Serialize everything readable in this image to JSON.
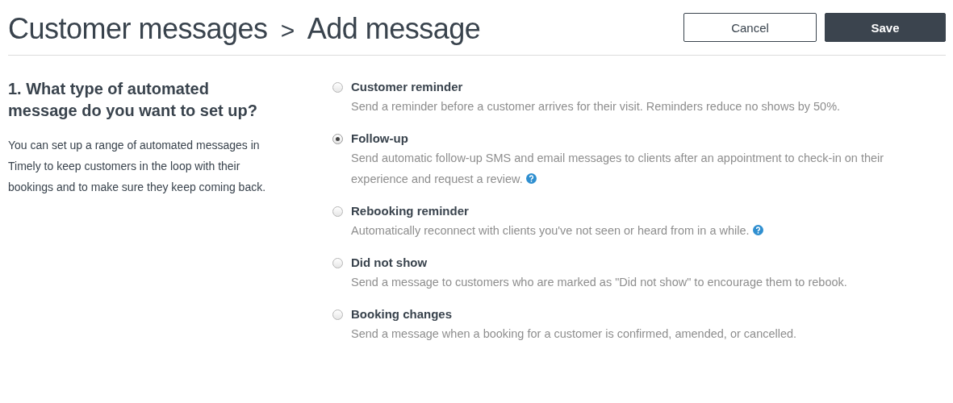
{
  "breadcrumb": {
    "parent": "Customer messages",
    "separator": ">",
    "current": "Add message"
  },
  "buttons": [
    {
      "label": "Cancel",
      "kind": "secondary"
    },
    {
      "label": "Save",
      "kind": "primary"
    }
  ],
  "section": {
    "heading": "1. What type of automated message do you want to set up?",
    "description": "You can set up a range of automated messages in Timely to keep customers in the loop with their bookings and to make sure they keep coming back."
  },
  "options": [
    {
      "label": "Customer reminder",
      "description": "Send a reminder before a customer arrives for their visit. Reminders reduce no shows by 50%.",
      "selected": false,
      "help": false
    },
    {
      "label": "Follow-up",
      "description": "Send automatic follow-up SMS and email messages to clients after an appointment to check-in on their experience and request a review.",
      "selected": true,
      "help": true
    },
    {
      "label": "Rebooking reminder",
      "description": "Automatically reconnect with clients you've not seen or heard from in a while.",
      "selected": false,
      "help": true
    },
    {
      "label": "Did not show",
      "description": "Send a message to customers who are marked as \"Did not show\" to encourage them to rebook.",
      "selected": false,
      "help": false
    },
    {
      "label": "Booking changes",
      "description": "Send a message when a booking for a customer is confirmed, amended, or cancelled.",
      "selected": false,
      "help": false
    }
  ]
}
